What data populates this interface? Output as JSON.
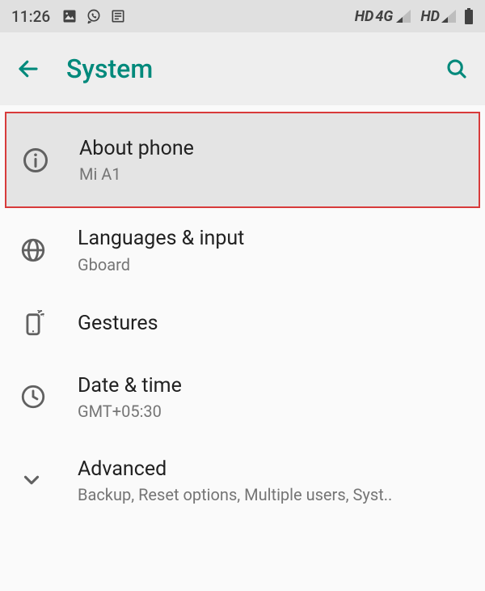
{
  "statusbar": {
    "time": "11:26",
    "hd1": "HD",
    "net1": "4G",
    "hd2": "HD"
  },
  "appbar": {
    "title": "System"
  },
  "items": [
    {
      "title": "About phone",
      "subtitle": "Mi A1"
    },
    {
      "title": "Languages & input",
      "subtitle": "Gboard"
    },
    {
      "title": "Gestures",
      "subtitle": ""
    },
    {
      "title": "Date & time",
      "subtitle": "GMT+05:30"
    },
    {
      "title": "Advanced",
      "subtitle": "Backup, Reset options, Multiple users, Syst.."
    }
  ],
  "colors": {
    "accent": "#00897b"
  }
}
